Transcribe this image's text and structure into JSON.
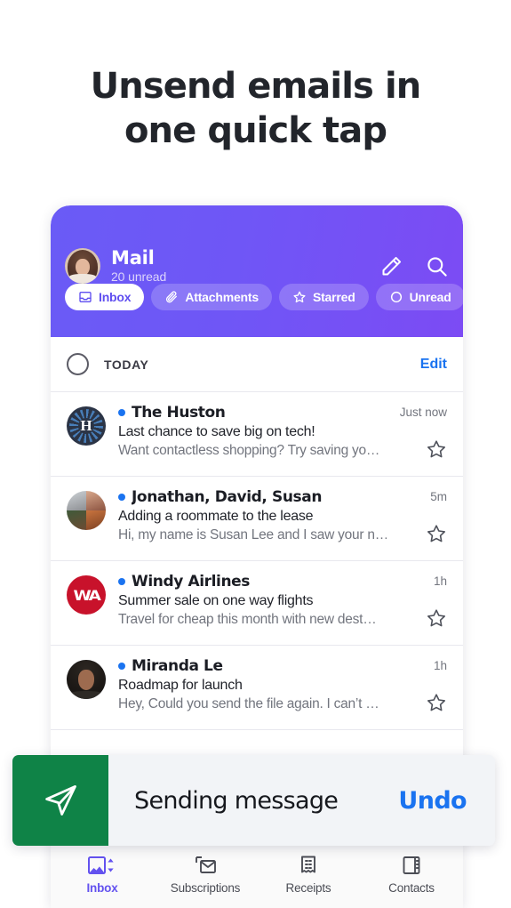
{
  "headline": "Unsend emails in one quick tap",
  "headline_line1": "Unsend emails in",
  "headline_line2": "one quick tap",
  "colors": {
    "header_purple_start": "#6a5bf6",
    "header_purple_end": "#7c4bf4",
    "accent_blue": "#1a73f0",
    "send_green": "#0f8347",
    "active_nav_purple": "#6352ef",
    "windy_red": "#c8122b",
    "huston_navy": "#2b3446"
  },
  "app_header": {
    "avatar": "user-photo-avatar",
    "title": "Mail",
    "subtitle": "20 unread",
    "compose_icon": "pencil-icon",
    "search_icon": "search-icon",
    "chips": [
      {
        "label": "Inbox",
        "icon": "inbox-tray-icon",
        "active": true
      },
      {
        "label": "Attachments",
        "icon": "paperclip-icon",
        "active": false
      },
      {
        "label": "Starred",
        "icon": "star-icon",
        "active": false
      },
      {
        "label": "Unread",
        "icon": "circle-icon",
        "active": false
      }
    ]
  },
  "list_header": {
    "select_all_icon": "empty-circle-icon",
    "section_label": "TODAY",
    "edit_label": "Edit"
  },
  "emails": [
    {
      "avatar": "huston-logo-avatar",
      "sender": "The Huston",
      "subject": "Last chance to save big on tech!",
      "preview": "Want contactless shopping? Try saving yo…",
      "time": "Just now",
      "unread": true,
      "starred": false
    },
    {
      "avatar": "group-photos-avatar",
      "sender": "Jonathan, David, Susan",
      "subject": "Adding a roommate to the lease",
      "preview": "Hi, my name is Susan Lee and I saw your n…",
      "time": "5m",
      "unread": true,
      "starred": false
    },
    {
      "avatar": "windy-airlines-logo-avatar",
      "sender": "Windy Airlines",
      "subject": "Summer sale on one way flights",
      "preview": "Travel for cheap this month with new dest…",
      "time": "1h",
      "unread": true,
      "starred": false
    },
    {
      "avatar": "miranda-photo-avatar",
      "sender": "Miranda Le",
      "subject": "Roadmap for launch",
      "preview": "Hey, Could you send the file again. I can’t …",
      "time": "1h",
      "unread": true,
      "starred": false
    }
  ],
  "toast": {
    "icon": "paper-plane-icon",
    "message": "Sending message",
    "action_label": "Undo"
  },
  "bottom_nav": [
    {
      "label": "Inbox",
      "icon": "inbox-sort-icon",
      "active": true
    },
    {
      "label": "Subscriptions",
      "icon": "subscriptions-envelope-icon",
      "active": false
    },
    {
      "label": "Receipts",
      "icon": "receipt-icon",
      "active": false
    },
    {
      "label": "Contacts",
      "icon": "contacts-card-icon",
      "active": false
    }
  ]
}
